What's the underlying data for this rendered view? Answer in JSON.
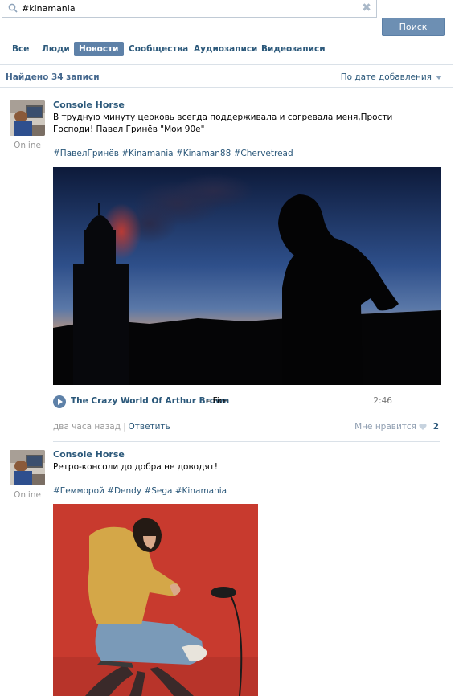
{
  "search": {
    "value": "#kinamania",
    "button": "Поиск"
  },
  "tabs": [
    {
      "label": "Все"
    },
    {
      "label": "Люди"
    },
    {
      "label": "Новости"
    },
    {
      "label": "Сообщества"
    },
    {
      "label": "Аудиозаписи"
    },
    {
      "label": "Видеозаписи"
    }
  ],
  "summary": {
    "found": "Найдено 34 записи",
    "sort": "По дате добавления"
  },
  "posts": [
    {
      "author": "Console Horse",
      "status": "Online",
      "text_line1": "В трудную минуту церковь всегда поддерживала и согревала меня,Прости",
      "text_line2": "Господи! Павел Гринёв \"Мои 90е\"",
      "tags": "#ПавелГринёв #Kinamania #Kinaman88 #Chervetread",
      "audio": {
        "artist": "The Crazy World Of Arthur Brown",
        "title": "Fire",
        "duration": "2:46"
      },
      "time": "два часа назад",
      "reply": "Ответить",
      "like_label": "Мне нравится",
      "like_count": "2"
    },
    {
      "author": "Console Horse",
      "status": "Online",
      "text_line1": "Ретро-консоли до добра не доводят!",
      "tags": "#Гемморой #Dendy #Sega #Kinamania"
    }
  ]
}
